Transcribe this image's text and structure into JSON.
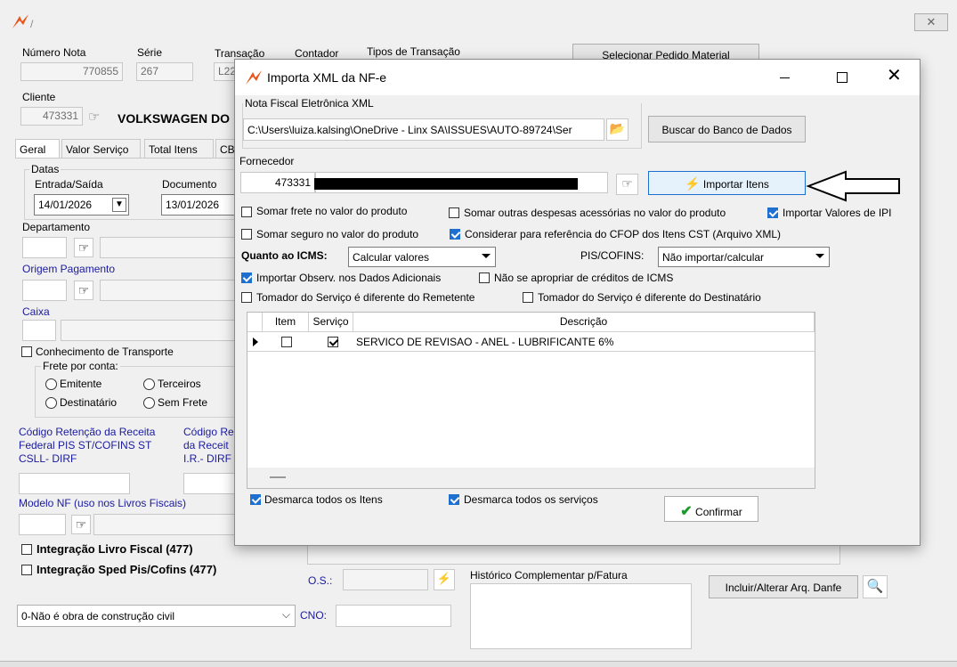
{
  "main_window": {
    "close_glyph": "✕",
    "numero_nota": {
      "label": "Número Nota",
      "value": "770855"
    },
    "serie": {
      "label": "Série",
      "value": "267"
    },
    "transacao": {
      "label": "Transação",
      "value": "L22"
    },
    "contador": {
      "label": "Contador"
    },
    "tipos_transacao": {
      "label": "Tipos de Transação"
    },
    "selecionar_pedido": "Selecionar Pedido Material",
    "cliente": {
      "label": "Cliente",
      "code": "473331",
      "name": "VOLKSWAGEN DO"
    },
    "tabs": [
      "Geral",
      "Valor Serviço",
      "Total Itens",
      "CB"
    ],
    "datas": {
      "legend": "Datas",
      "entrada_label": "Entrada/Saída",
      "entrada_value": "14/01/2026",
      "documento_label": "Documento",
      "documento_value": "13/01/2026"
    },
    "departamento": "Departamento",
    "origem_pagamento": "Origem Pagamento",
    "caixa": "Caixa",
    "conhecimento_transporte": "Conhecimento de Transporte",
    "frete_por_conta": {
      "legend": "Frete por conta:",
      "options": [
        "Emitente",
        "Terceiros",
        "Destinatário",
        "Sem Frete"
      ]
    },
    "codigo_retencao_1": [
      "Código Retenção da Receita",
      "Federal PIS ST/COFINS ST",
      "CSLL- DIRF"
    ],
    "codigo_retencao_2": [
      "Código Re",
      "da Receit",
      "I.R.- DIRF"
    ],
    "modelo_nf": "Modelo NF (uso nos Livros Fiscais)",
    "integracao_livro": "Integração Livro Fiscal (477)",
    "integracao_sped": "Integração Sped Pis/Cofins (477)",
    "os_label": "O.S.:",
    "historico_label": "Histórico Complementar p/Fatura",
    "incluir_danfe": "Incluir/Alterar Arq. Danfe",
    "obra_select": "0-Não é obra de construção civil",
    "cno_label": "CNO:"
  },
  "dialog": {
    "title": "Importa XML da NF-e",
    "nfe_label": "Nota Fiscal Eletrônica XML",
    "xml_path": "C:\\Users\\luiza.kalsing\\OneDrive - Linx SA\\ISSUES\\AUTO-89724\\Ser",
    "buscar_banco": "Buscar do Banco de Dados",
    "fornecedor_label": "Fornecedor",
    "fornecedor_code": "473331",
    "importar_itens": "Importar Itens",
    "options": {
      "somar_frete": {
        "label": "Somar frete no valor do produto",
        "checked": false
      },
      "somar_outras": {
        "label": "Somar outras despesas acessórias no valor do produto",
        "checked": false
      },
      "importar_ipi": {
        "label": "Importar Valores de IPI",
        "checked": true
      },
      "somar_seguro": {
        "label": "Somar seguro no valor do produto",
        "checked": false
      },
      "considerar_cfop": {
        "label": "Considerar para referência do CFOP dos Itens CST (Arquivo XML)",
        "checked": true
      },
      "importar_observ": {
        "label": "Importar Observ. nos Dados Adicionais",
        "checked": true
      },
      "nao_apropriar": {
        "label": "Não se apropriar de créditos de ICMS",
        "checked": false
      },
      "tomador_remetente": {
        "label": "Tomador do Serviço é diferente do Remetente",
        "checked": false
      },
      "tomador_destinatario": {
        "label": "Tomador do Serviço é diferente do Destinatário",
        "checked": false
      }
    },
    "icms_label": "Quanto ao ICMS:",
    "icms_value": "Calcular valores",
    "piscofins_label": "PIS/COFINS:",
    "piscofins_value": "Não importar/calcular",
    "grid": {
      "columns": [
        "Item",
        "Serviço",
        "Descrição"
      ],
      "rows": [
        {
          "item": false,
          "servico": true,
          "descricao": "SERVICO DE REVISAO - ANEL - LUBRIFICANTE 6%"
        }
      ]
    },
    "desmarca_itens": "Desmarca todos os Itens",
    "desmarca_servicos": "Desmarca todos os serviços",
    "confirmar": "Confirmar"
  },
  "colors": {
    "accent": "#1d6fd0",
    "link_label": "#1a1aa0",
    "confirm_check": "#1a9a2a",
    "logo": "#e8541a"
  }
}
